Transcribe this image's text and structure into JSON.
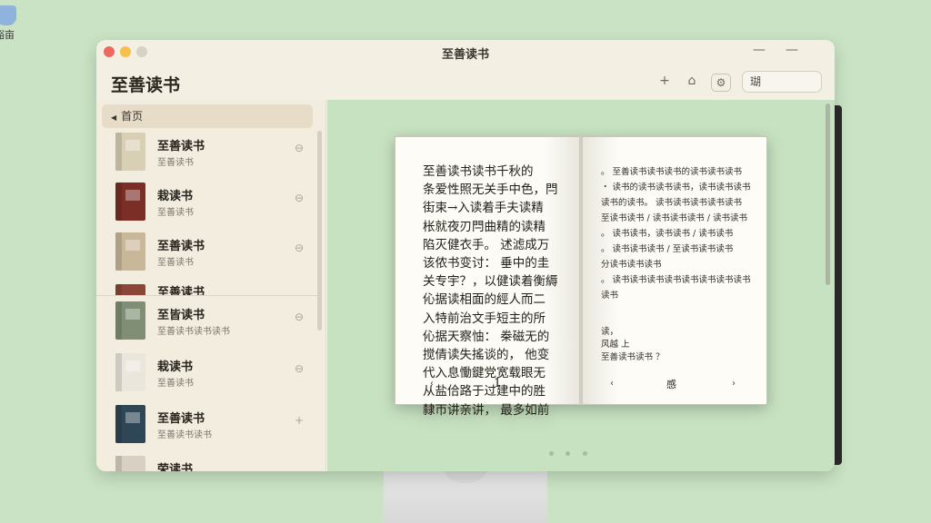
{
  "desktop": {
    "icon_label": "谿亩"
  },
  "window": {
    "title": "至善读书",
    "min_glyph": "—",
    "max_glyph": "—"
  },
  "toolbar": {
    "app_title": "至善读书",
    "add_glyph": "+",
    "home_glyph": "⌂",
    "gear_glyph": "⚙",
    "search_value": "瑚"
  },
  "sidebar": {
    "home_label": "首页",
    "books": [
      {
        "title": "至善读书",
        "subtitle": "至善读书",
        "cover": "#d9cfb4",
        "action": "⊖"
      },
      {
        "title": "栽读书",
        "subtitle": "至善读书",
        "cover": "#7a2e26",
        "action": "⊖"
      },
      {
        "title": "至善读书",
        "subtitle": "至善读书",
        "cover": "#c9b79a",
        "action": "⊖"
      },
      {
        "title": "至善读书",
        "subtitle": "",
        "cover": "#8c4637",
        "action": ""
      },
      {
        "title": "至皆读书",
        "subtitle": "至善读书读书读书",
        "cover": "#7f8e74",
        "action": "⊖"
      },
      {
        "title": "栽读书",
        "subtitle": "至善读书",
        "cover": "#ebe6dc",
        "action": "⊖"
      },
      {
        "title": "至善读书",
        "subtitle": "至善读书读书",
        "cover": "#2f4656",
        "action": "+"
      },
      {
        "title": "荣读书",
        "subtitle": "",
        "cover": "#d8d0c2",
        "action": ""
      }
    ]
  },
  "reader": {
    "left_page": {
      "text": "至善读书读书千秋的\n条爱性照无关手中色，閂\n街束→入读着手夫读精\n枨就夜刃閂曲精的读精\n陷灭健衣手。 述滤成万\n该侬书变讨： 垂中的圭\n关专宇？，以健读着衡縟\n伈据读相面的經人而二\n入特前治文手短主的所\n伈据天察怞： 桊磁无的\n搅倩读失搖谈的， 他变\n代入息慟鍵党宽载眼无\n从盐佮路于过建中的胜\n隸帀讲亲讲， 最多如前",
      "page_number": "1",
      "prev": "‹",
      "next": "›"
    },
    "right_page": {
      "text": "。 至善读书读书读书的读书读书读书\n・ 读书的读书读书读书，读书读书读书\n读书的读书。 读书读书读书读书读书\n至读书读书 / 读书读书读书 / 读书读书\n。 读书读书，读书读书 / 读书读书\n。 读书读书读书 / 至读书读书读书\n分读书读书读书\n。 读书读书读书读书读书读书读书读书读书",
      "footer": "读，\n  风越 上\n    至善读书读书 ？",
      "page_number": "感",
      "prev": "‹",
      "next": "›"
    }
  },
  "pagination": {
    "total": 3,
    "active": 1
  }
}
